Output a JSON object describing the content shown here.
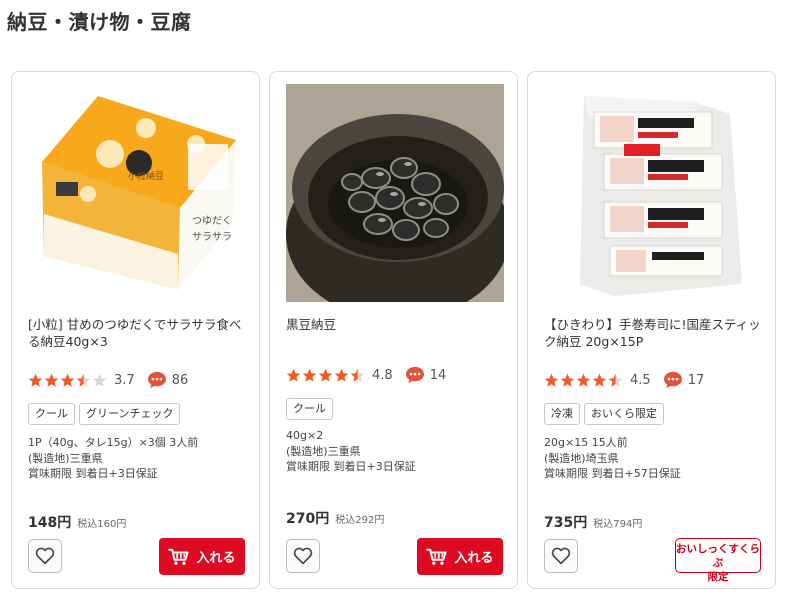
{
  "section": {
    "title": "納豆・漬け物・豆腐"
  },
  "products": [
    {
      "name": "[小粒] 甘めのつゆだくでサラサラ食べる納豆40g×3",
      "rating": 3.5,
      "rating_text": "3.7",
      "reviews": "86",
      "tags": [
        "クール",
        "グリーンチェック"
      ],
      "details": [
        "1P（40g、タレ15g）×3個 3人前",
        "(製造地)三重県",
        "賞味期限 到着日+3日保証"
      ],
      "price": "148円",
      "price_tax": "税込160円",
      "action": "入れる",
      "action_type": "cart",
      "image_icon": "natto-cup-image"
    },
    {
      "name": "黒豆納豆",
      "rating": 4.5,
      "rating_text": "4.8",
      "reviews": "14",
      "tags": [
        "クール"
      ],
      "details": [
        "40g×2",
        "(製造地)三重県",
        "賞味期限 到着日+3日保証"
      ],
      "price": "270円",
      "price_tax": "税込292円",
      "action": "入れる",
      "action_type": "cart",
      "image_icon": "black-bean-bowl-image"
    },
    {
      "name": "【ひきわり】手巻寿司に!国産スティック納豆 20g×15P",
      "rating": 4.5,
      "rating_text": "4.5",
      "reviews": "17",
      "tags": [
        "冷凍",
        "おいくら限定"
      ],
      "details": [
        "20g×15 15人前",
        "(製造地)埼玉県",
        "賞味期限 到着日+57日保証"
      ],
      "price": "735円",
      "price_tax": "税込794円",
      "action_lines": [
        "おいしっくすくらぶ",
        "限定"
      ],
      "action_type": "members-only",
      "image_icon": "stick-natto-pack-image"
    }
  ],
  "colors": {
    "star": "#f05a24",
    "star_empty": "#d6d6d6",
    "comment": "#e4503a",
    "cart": "#dd0a22",
    "limited": "#c4001c"
  }
}
